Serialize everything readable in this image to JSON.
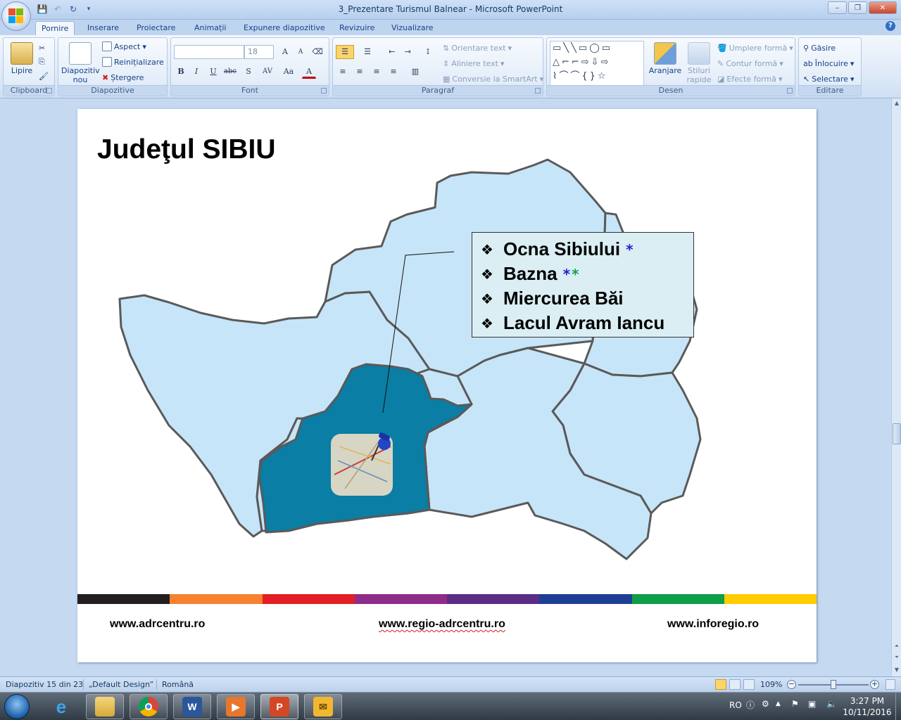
{
  "window": {
    "title": "3_Prezentare Turismul Balnear - Microsoft PowerPoint",
    "minimize": "–",
    "maximize": "❐",
    "close": "✕"
  },
  "tabs": [
    "Pornire",
    "Inserare",
    "Proiectare",
    "Animații",
    "Expunere diapozitive",
    "Revizuire",
    "Vizualizare"
  ],
  "ribbon": {
    "clipboard": {
      "label": "Clipboard",
      "paste": "Lipire"
    },
    "slides": {
      "label": "Diapozitive",
      "new_slide_1": "Diapozitiv",
      "new_slide_2": "nou",
      "layout": "Aspect",
      "reset": "Reinițializare",
      "delete": "Ștergere"
    },
    "font": {
      "label": "Font",
      "size": "18",
      "bold": "B",
      "italic": "I",
      "underline": "U",
      "strike": "abc",
      "shadow": "S",
      "spacing": "AV",
      "case": "Aa"
    },
    "paragraph": {
      "label": "Paragraf",
      "text_direction": "Orientare text",
      "align_text": "Aliniere text",
      "smartart": "Conversie la SmartArt"
    },
    "drawing": {
      "label": "Desen",
      "arrange": "Aranjare",
      "quick_styles_1": "Stiluri",
      "quick_styles_2": "rapide",
      "fill": "Umplere formă",
      "outline": "Contur formă",
      "effects": "Efecte formă"
    },
    "editing": {
      "label": "Editare",
      "find": "Găsire",
      "replace": "Înlocuire",
      "select": "Selectare"
    }
  },
  "slide": {
    "title": "Judeţul SIBIU",
    "bullet_glyph": "❖",
    "callout_items": [
      {
        "text": "Ocna Sibiului",
        "stars": [
          {
            "glyph": "*",
            "color": "#1f1fd6"
          }
        ]
      },
      {
        "text": "Bazna",
        "stars": [
          {
            "glyph": "*",
            "color": "#1f1fd6"
          },
          {
            "glyph": "*",
            "color": "#17a34a"
          }
        ]
      },
      {
        "text": "Miercurea Băi",
        "stars": []
      },
      {
        "text": "Lacul Avram Iancu",
        "stars": []
      }
    ],
    "footer_links": [
      "www.adrcentru.ro",
      "www.regio-adrcentru.ro",
      "www.inforegio.ro"
    ],
    "color_bar": [
      "#231f20",
      "#f58231",
      "#e31e24",
      "#8e2c8a",
      "#5b2d86",
      "#1e3f94",
      "#0f9d48",
      "#ffcc00"
    ],
    "map_colors": {
      "region": "#c7e5f8",
      "highlight": "#0a7ea4",
      "border": "#5a5a5a"
    }
  },
  "statusbar": {
    "slide_info": "Diapozitiv 15 din 23",
    "theme": "„Default Design”",
    "language": "Română",
    "zoom": "109%"
  },
  "taskbar": {
    "language": "RO",
    "time": "3:27 PM",
    "date": "10/11/2016",
    "apps": [
      "internet-explorer",
      "file-explorer",
      "chrome",
      "word",
      "media-player",
      "powerpoint",
      "outlook"
    ]
  }
}
